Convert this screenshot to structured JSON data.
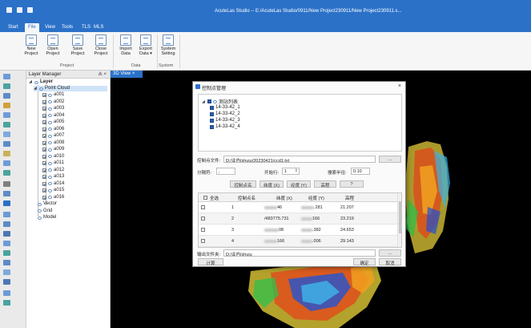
{
  "titlebar": {
    "title": "AcuteLas Studio -- E:/AcuteLas Studio/0911/New Project230911/New Project230911.s..."
  },
  "tabs": [
    "Start",
    "File",
    "View",
    "Tools",
    "TLS",
    "MLS"
  ],
  "active_tab": "File",
  "ribbon": {
    "groups": [
      {
        "label": "Project",
        "buttons": [
          {
            "line1": "New",
            "line2": "Project",
            "icon": "new-project-icon"
          },
          {
            "line1": "Open",
            "line2": "Project",
            "icon": "open-project-icon"
          },
          {
            "line1": "Save",
            "line2": "Project",
            "icon": "save-project-icon"
          },
          {
            "line1": "Close",
            "line2": "Project",
            "icon": "close-project-icon"
          }
        ]
      },
      {
        "label": "Data",
        "buttons": [
          {
            "line1": "Import",
            "line2": "Data",
            "icon": "import-data-icon"
          },
          {
            "line1": "Export",
            "line2": "Data ▾",
            "icon": "export-data-icon"
          }
        ]
      },
      {
        "label": "System",
        "buttons": [
          {
            "line1": "System",
            "line2": "Setting",
            "icon": "system-setting-icon"
          }
        ]
      }
    ]
  },
  "layer_manager": {
    "title": "Layer Manager",
    "pin_glyph": "♵ ×",
    "root": "Layer",
    "point_cloud": "Point Cloud",
    "items": [
      "a001",
      "a002",
      "a003",
      "a004",
      "a005",
      "a006",
      "a007",
      "a008",
      "a009",
      "a010",
      "a011",
      "a012",
      "a013",
      "a014",
      "a015",
      "a016"
    ],
    "others": [
      "Vector",
      "Grid",
      "Model"
    ]
  },
  "view": {
    "tab_label": "3D View ×"
  },
  "dialog": {
    "title": "控制点管理",
    "close_glyph": "×",
    "tree_root": "测站列表",
    "stations": [
      "14-33-42_1",
      "14-33-42_2",
      "14-33-42_3",
      "14-33-42_4"
    ],
    "file_label": "控制点文件:",
    "file_path": "D:/业内/shuju/20230421/ccd1.txt",
    "browse_label": "...",
    "sep_label": "分隔符:",
    "sep_value": ",",
    "start_row_label": "开始行:",
    "start_row_value": "1",
    "search_radius_label": "搜索半径:",
    "search_radius_value": "0.10",
    "col_buttons": [
      "控制点名",
      "纬度 (X)",
      "经度 (Y)",
      "高程",
      "?"
    ],
    "grid_headers": [
      "全选",
      "控制点名",
      "纬度 (X)",
      "经度 (Y)",
      "高程"
    ],
    "rows": [
      {
        "no": "1",
        "x": "46",
        "y": ".281",
        "z": "21.207"
      },
      {
        "no": "2",
        "x": "/483775.731",
        "y": "166",
        "z": "23.219"
      },
      {
        "no": "3",
        "x": "08",
        "y": ".382",
        "z": "24.653"
      },
      {
        "no": "4",
        "x": "166",
        "y": ".006",
        "z": "29.143"
      }
    ],
    "output_label": "输出文件夹:",
    "output_path": "D:/业内/shuju",
    "output_browse": "...",
    "compute_button": "计算",
    "ok_button": "确定",
    "cancel_button": "取消"
  },
  "colors": {
    "accent": "#2b71c8",
    "viewport_bg": "#000000"
  }
}
